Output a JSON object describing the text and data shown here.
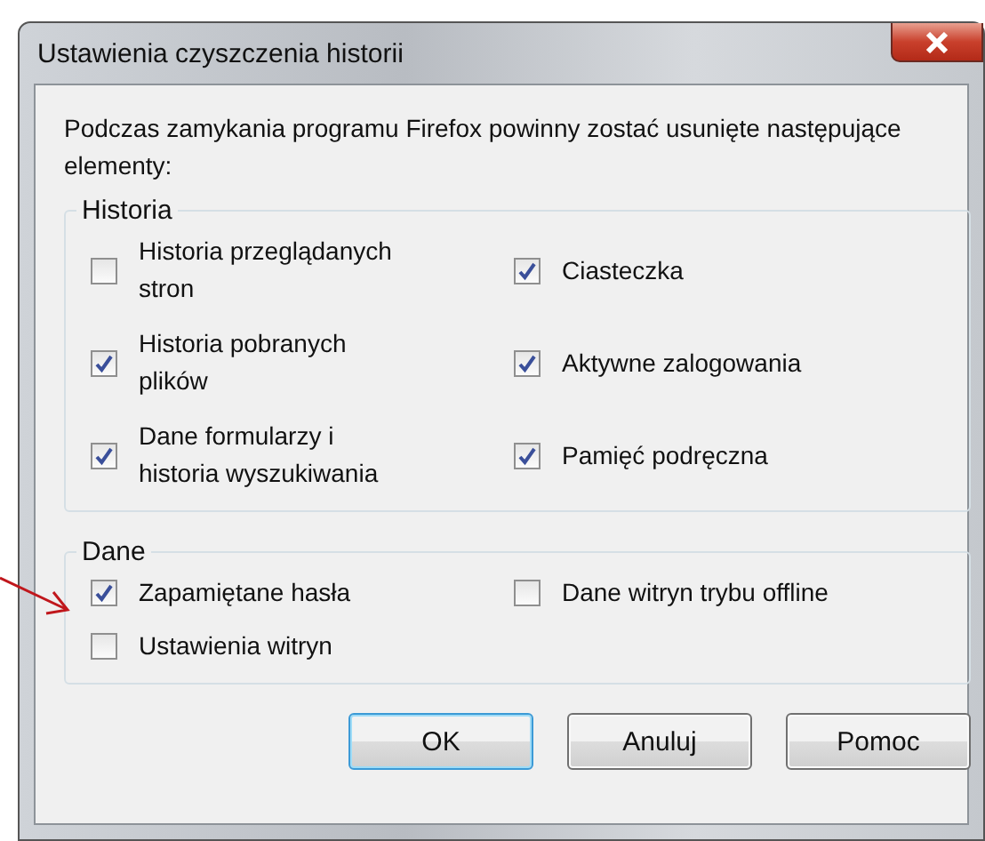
{
  "window": {
    "title": "Ustawienia czyszczenia historii"
  },
  "description": "Podczas zamykania programu Firefox powinny zostać usunięte następujące elementy:",
  "groups": [
    {
      "title": "Historia",
      "items": [
        {
          "label": "Historia przeglądanych stron",
          "checked": false
        },
        {
          "label": "Ciasteczka",
          "checked": true
        },
        {
          "label": "Historia pobranych plików",
          "checked": true
        },
        {
          "label": "Aktywne zalogowania",
          "checked": true
        },
        {
          "label": "Dane formularzy i historia wyszukiwania",
          "checked": true
        },
        {
          "label": "Pamięć podręczna",
          "checked": true
        }
      ]
    },
    {
      "title": "Dane",
      "items": [
        {
          "label": "Zapamiętane hasła",
          "checked": true
        },
        {
          "label": "Dane witryn trybu offline",
          "checked": false
        },
        {
          "label": "Ustawienia witryn",
          "checked": false
        }
      ]
    }
  ],
  "buttons": [
    {
      "label": "OK",
      "default": true
    },
    {
      "label": "Anuluj",
      "default": false
    },
    {
      "label": "Pomoc",
      "default": false
    }
  ]
}
